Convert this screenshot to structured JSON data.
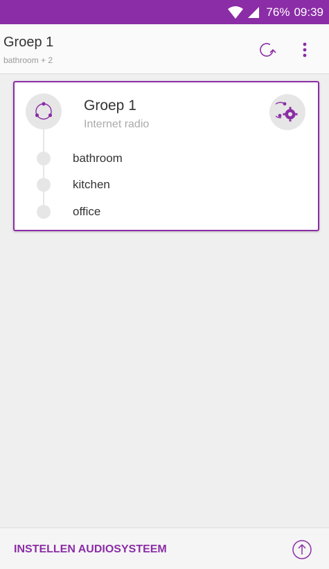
{
  "status_bar": {
    "battery": "76%",
    "time": "09:39"
  },
  "app_bar": {
    "title": "Groep 1",
    "subtitle": "bathroom + 2",
    "icons": [
      "refresh-icon",
      "more-vert-icon"
    ]
  },
  "group_card": {
    "title": "Groep 1",
    "source": "Internet radio",
    "rooms": [
      {
        "label": "bathroom"
      },
      {
        "label": "kitchen"
      },
      {
        "label": "office"
      }
    ],
    "icons": [
      "group-icon",
      "group-settings-icon"
    ]
  },
  "bottom_bar": {
    "setup_label": "INSTELLEN AUDIOSYSTEEM",
    "icons": [
      "upload-icon"
    ]
  },
  "colors": {
    "accent": "#8b2da6",
    "background": "#efefef",
    "card": "#ffffff"
  }
}
